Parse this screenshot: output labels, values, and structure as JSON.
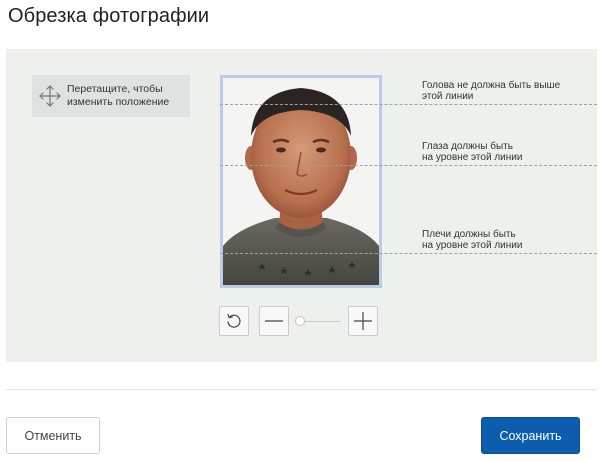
{
  "page": {
    "title": "Обрезка фотографии"
  },
  "drag_hint": {
    "icon": "move-arrows-icon",
    "line1": "Перетащите, чтобы",
    "line2": "изменить положение"
  },
  "guides": {
    "head": {
      "line1": "Голова не должна быть выше",
      "line2": "этой линии"
    },
    "eyes": {
      "line1": "Глаза должны быть",
      "line2": "на уровне этой линии"
    },
    "shoulders": {
      "line1": "Плечи должны быть",
      "line2": "на уровне этой линии"
    }
  },
  "controls": {
    "rotate_icon": "rotate-left-icon",
    "zoom_out_icon": "minus-icon",
    "zoom_in_icon": "plus-icon",
    "zoom_level": 0
  },
  "footer": {
    "cancel_label": "Отменить",
    "save_label": "Сохранить"
  },
  "colors": {
    "primary": "#0c5dae",
    "stage_bg": "#eef0ee",
    "frame_border": "#b9cde6"
  }
}
